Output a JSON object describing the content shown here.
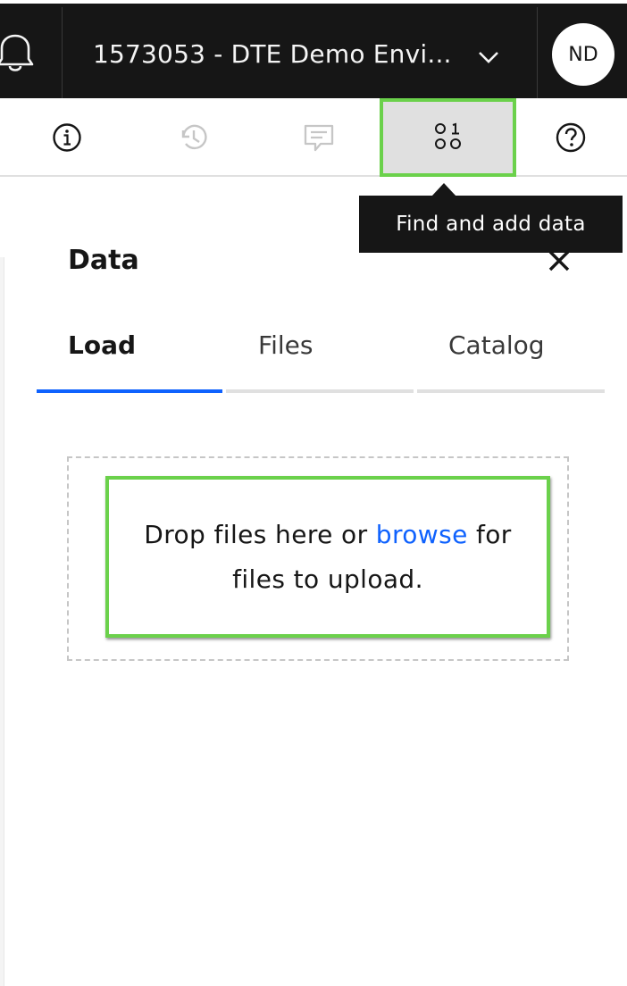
{
  "header": {
    "environment_name": "1573053 - DTE Demo Envi...",
    "avatar_initials": "ND",
    "icons": {
      "notifications": "bell-icon",
      "environment_switch": "chevron-down-icon"
    }
  },
  "toolbar": {
    "buttons": [
      {
        "icon": "info-icon",
        "enabled": true
      },
      {
        "icon": "history-icon",
        "enabled": false
      },
      {
        "icon": "comment-icon",
        "enabled": false
      },
      {
        "icon": "find-data-icon",
        "enabled": true,
        "active": true
      },
      {
        "icon": "help-icon",
        "enabled": true
      }
    ],
    "tooltip": "Find and add data"
  },
  "panel": {
    "title": "Data",
    "close_icon": "close-icon",
    "tabs": [
      {
        "label": "Load",
        "selected": true
      },
      {
        "label": "Files",
        "selected": false
      },
      {
        "label": "Catalog",
        "selected": false
      }
    ],
    "dropzone": {
      "text_before": "Drop files here or ",
      "link": "browse",
      "text_after": " for files to upload."
    }
  },
  "colors": {
    "header_bg": "#161616",
    "accent_blue": "#0f62fe",
    "highlight_green": "#6bd14b",
    "tab_inactive": "#e0e0e0",
    "disabled_icon": "#c6c6c6"
  }
}
